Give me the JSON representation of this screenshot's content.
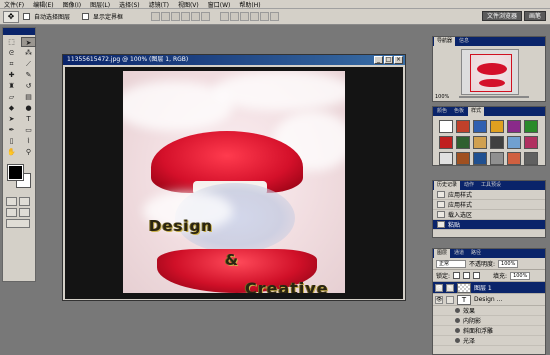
{
  "menu": [
    "文件(F)",
    "编辑(E)",
    "图像(I)",
    "图层(L)",
    "选择(S)",
    "滤镜(T)",
    "视图(V)",
    "窗口(W)",
    "帮助(H)"
  ],
  "options": {
    "auto_select_layer": "自动选择图层",
    "show_bounding_box": "显示定界框",
    "well_tabs": [
      "文件浏览器",
      "画笔"
    ]
  },
  "document": {
    "title": "11355615472.jpg @ 100% (图层 1, RGB)",
    "text_line1": "Design",
    "text_line2": "&",
    "text_line3": "Creative",
    "colors": {
      "lip": "#d4102a",
      "backdrop": "#141414",
      "text": "#2a2412"
    }
  },
  "navigator": {
    "tabs": [
      "导航器",
      "信息"
    ],
    "zoom": "100%"
  },
  "styles": {
    "tabs": [
      "颜色",
      "色板",
      "样式"
    ],
    "swatches": [
      "#ffffff",
      "#c0402a",
      "#3060b0",
      "#e0a020",
      "#8a2a8a",
      "#2a8a2a",
      "#c02020",
      "#306030",
      "#d0a050",
      "#404040",
      "#70a0d0",
      "#b03060",
      "#e0e0e0",
      "#a05020",
      "#205090",
      "#909090",
      "#d06040",
      "#606060"
    ]
  },
  "history": {
    "tabs": [
      "历史记录",
      "动作",
      "工具预设"
    ],
    "items": [
      "应用样式",
      "应用样式",
      "载入选区",
      "粘贴"
    ],
    "active_index": 3
  },
  "layers": {
    "tabs": [
      "图层",
      "通道",
      "路径"
    ],
    "blend_mode": "正常",
    "opacity_label": "不透明度:",
    "opacity": "100%",
    "lock_label": "锁定:",
    "fill_label": "填充:",
    "fill": "100%",
    "rows": [
      {
        "name": "图层 1",
        "kind": "image",
        "active": true
      },
      {
        "name": "Design ...",
        "kind": "text",
        "active": false
      }
    ],
    "effects_label": "效果",
    "effects": [
      "内阴影",
      "斜面和浮雕",
      "光泽"
    ]
  }
}
